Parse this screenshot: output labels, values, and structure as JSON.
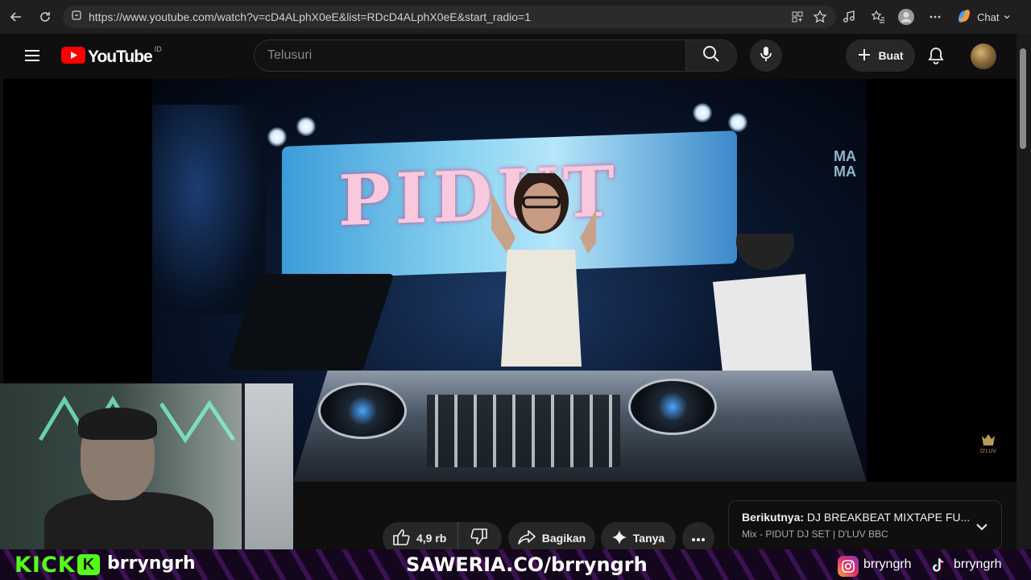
{
  "browser": {
    "url": "https://www.youtube.com/watch?v=cD4ALphX0eE&list=RDcD4ALphX0eE&start_radio=1",
    "chat_label": "Chat"
  },
  "header": {
    "logo_text": "YouTube",
    "region_code": "ID",
    "search_placeholder": "Telusuri",
    "create_label": "Buat"
  },
  "video": {
    "stage_screen_text": "PIDUT",
    "side_screen_text": "MA MA",
    "corner_logo": "D'LUV"
  },
  "actions": {
    "like_count": "4,9 rb",
    "share_label": "Bagikan",
    "ask_label": "Tanya"
  },
  "up_next": {
    "label": "Berikutnya:",
    "title": "DJ BREAKBEAT MIXTAPE FU...",
    "subtitle": "Mix - PIDUT DJ SET | D'LUV BBC"
  },
  "stream_overlay": {
    "kick_label": "KICK",
    "kick_badge": "K",
    "kick_handle": "brryngrh",
    "saweria_text": "SAWERIA.CO/brryngrh",
    "instagram_handle": "brryngrh",
    "tiktok_handle": "brryngrh"
  },
  "colors": {
    "youtube_red": "#ff0000",
    "kick_green": "#53fc18",
    "page_bg": "#0f0f0f"
  }
}
